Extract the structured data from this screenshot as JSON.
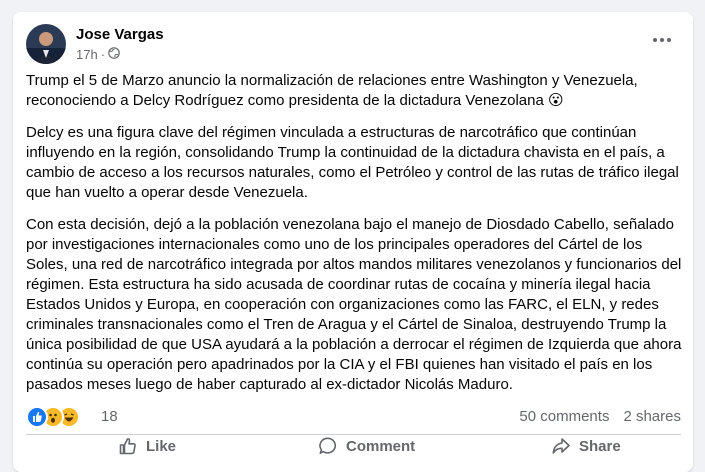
{
  "post": {
    "author": "Jose Vargas",
    "time": "17h",
    "privacy_icon": "globe-icon",
    "paragraphs": [
      "Trump el 5 de Marzo anuncio la normalización de relaciones entre Washington y Venezuela, reconociendo a Delcy Rodríguez como presidenta de la dictadura Venezolana 😮",
      "Delcy es una figura clave del régimen vinculada a estructuras de narcotráfico que continúan influyendo en la región, consolidando Trump la continuidad de la dictadura chavista en el país, a cambio de acceso a los recursos naturales, como el Petróleo y control de las rutas de tráfico ilegal que han vuelto a operar desde Venezuela.",
      "Con esta decisión, dejó a la población venezolana bajo el manejo de Diosdado Cabello, señalado por investigaciones internacionales como uno de los principales operadores del Cártel de los Soles, una red de narcotráfico integrada por altos mandos militares venezolanos y funcionarios del régimen. Esta estructura ha sido acusada de coordinar rutas de cocaína y minería ilegal hacia Estados Unidos y Europa, en cooperación con organizaciones como las FARC, el ELN, y redes criminales transnacionales como el Tren de Aragua y el Cártel de Sinaloa, destruyendo Trump la única posibilidad de que USA ayudará a la población a derrocar el régimen de Izquierda que ahora continúa su operación pero apadrinados por la CIA y el FBI quienes han visitado el país en los pasados meses luego de haber capturado al ex-dictador Nicolás Maduro."
    ]
  },
  "stats": {
    "reaction_icons": [
      "like-reaction-icon",
      "wow-reaction-icon",
      "haha-reaction-icon"
    ],
    "reaction_count": "18",
    "comments": "50 comments",
    "shares": "2 shares"
  },
  "actions": {
    "like": "Like",
    "comment": "Comment",
    "share": "Share"
  },
  "colors": {
    "background": "#f0f2f5",
    "card": "#ffffff",
    "secondary_text": "#65676b",
    "like_blue": "#1877f2",
    "reaction_yellow": "#f7b928"
  }
}
